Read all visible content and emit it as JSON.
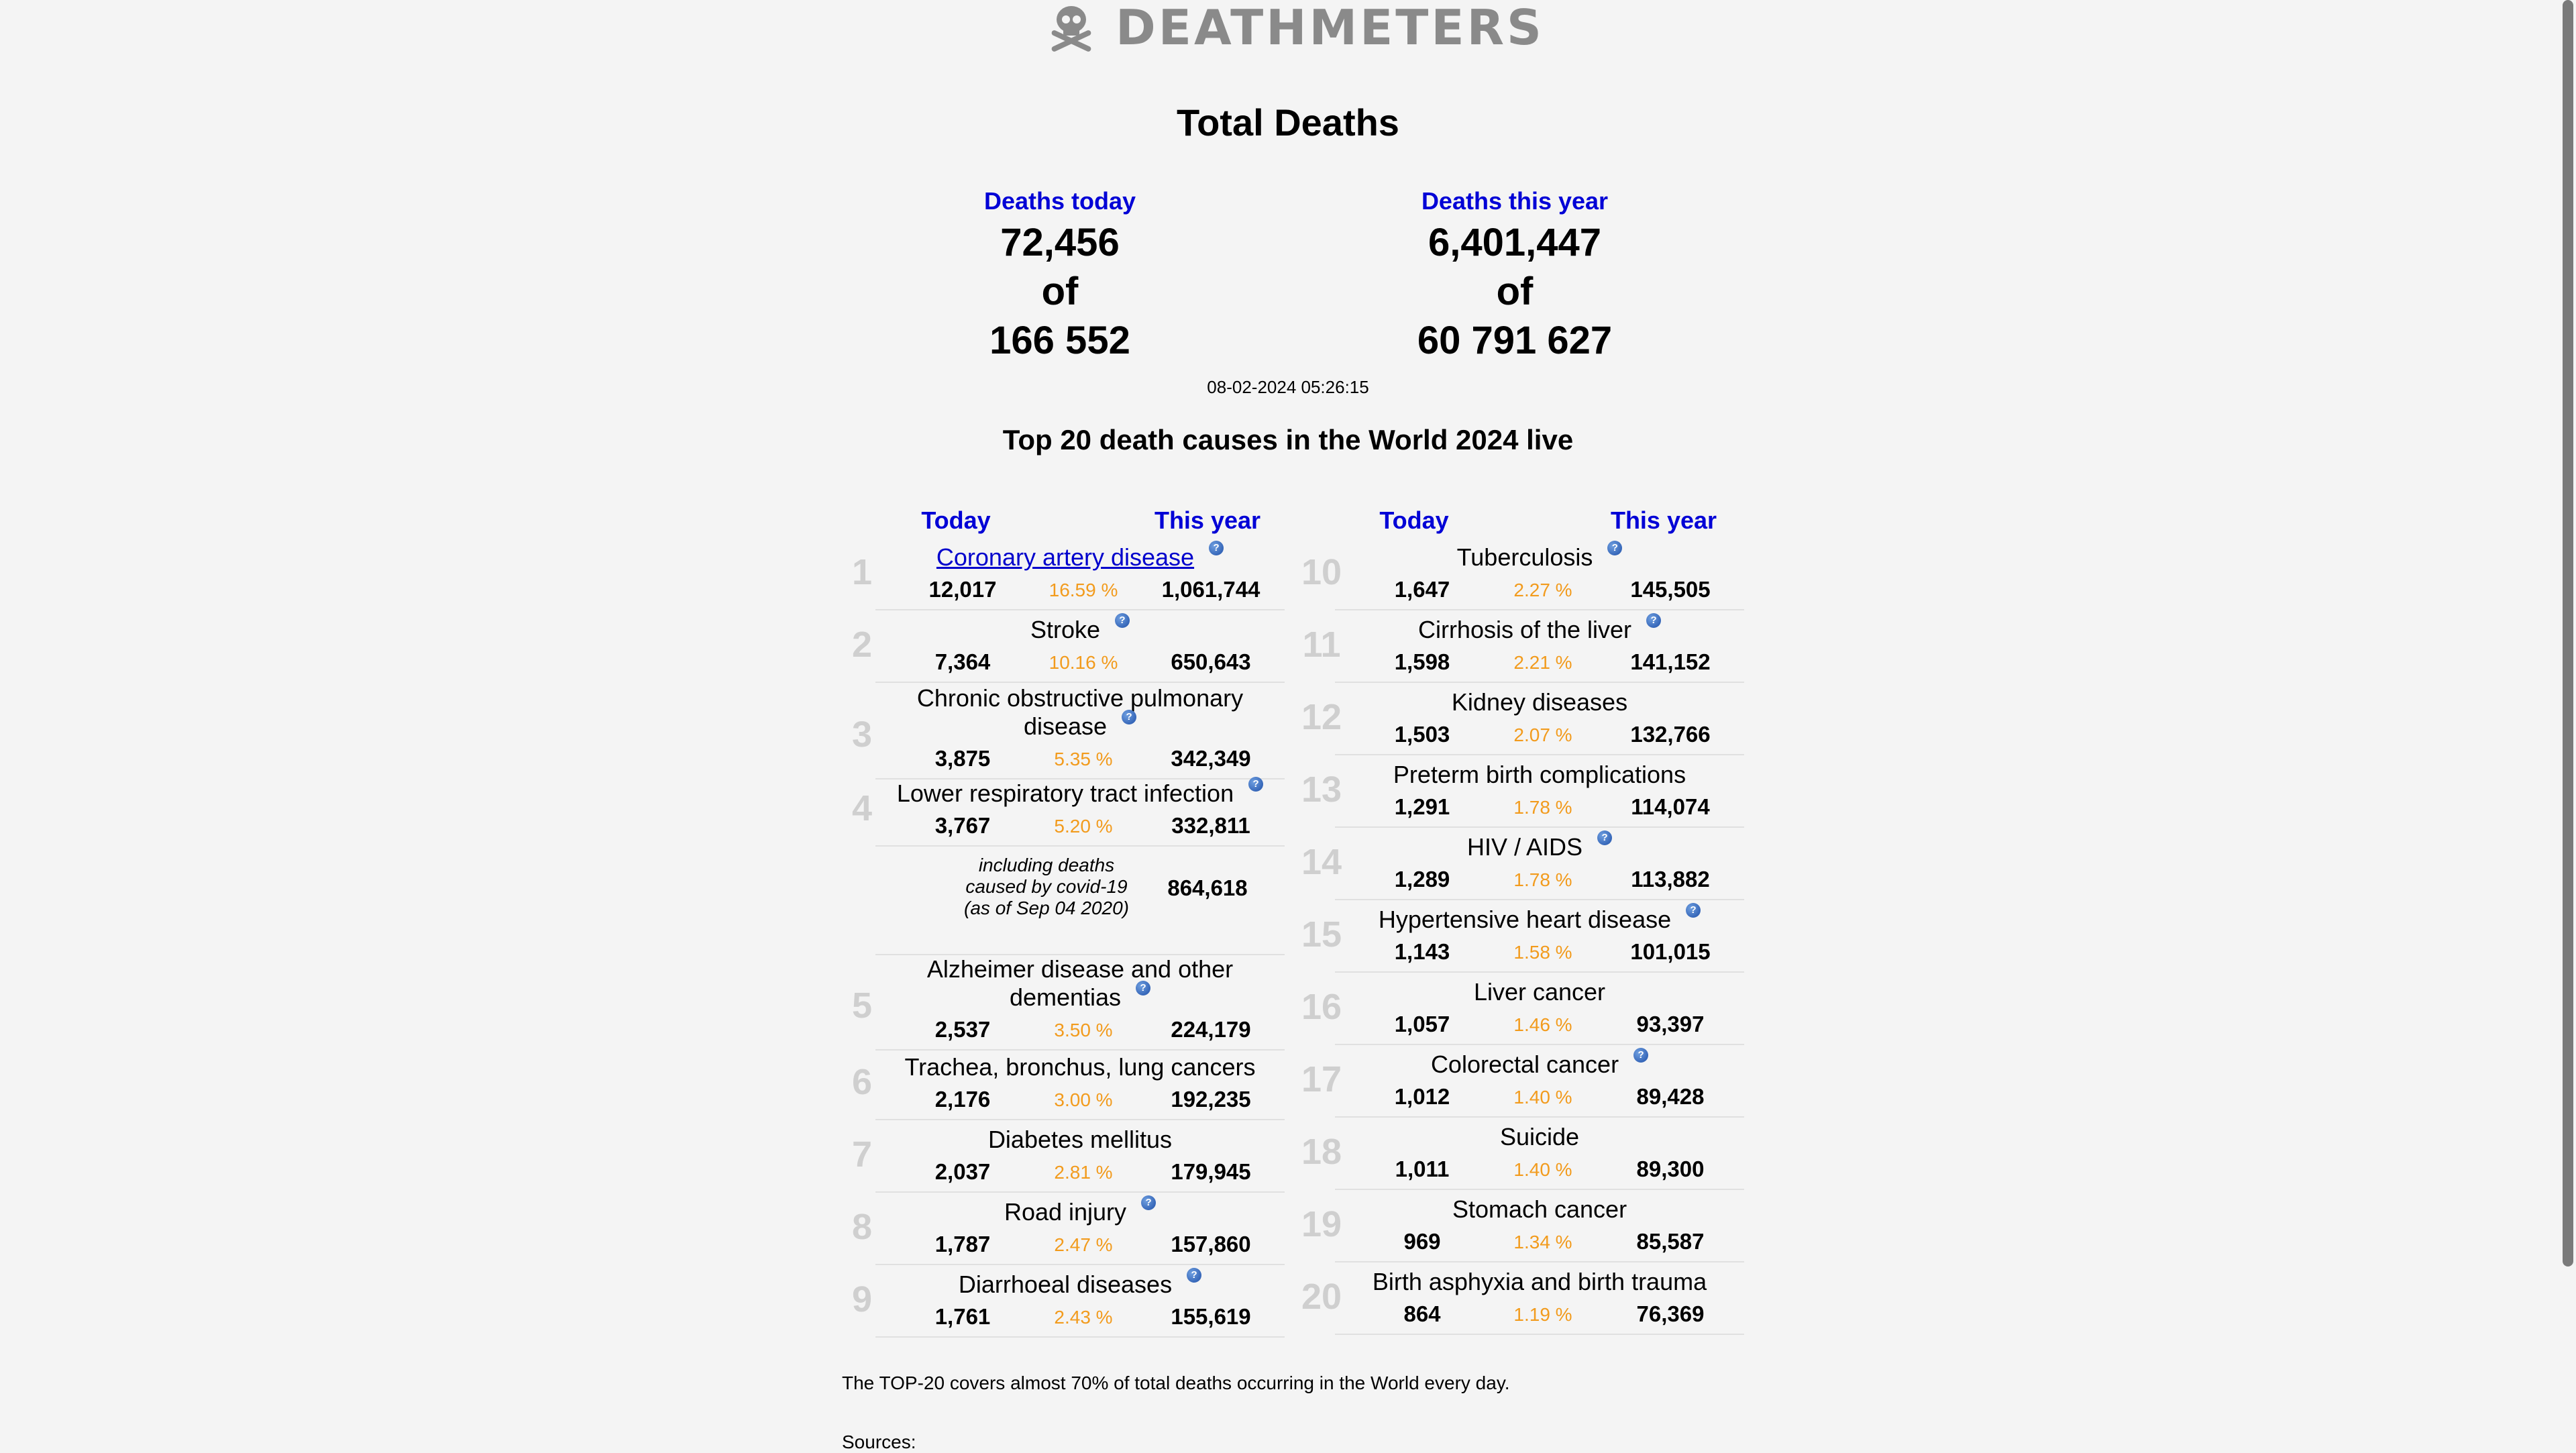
{
  "logo": {
    "text": "DEATHMETERS",
    "icon": "skull-crossbones-icon"
  },
  "title": "Total Deaths",
  "today": {
    "label": "Deaths today",
    "value": "72,456",
    "of": "of",
    "total": "166 552"
  },
  "year": {
    "label": "Deaths this year",
    "value": "6,401,447",
    "of": "of",
    "total": "60 791 627"
  },
  "timestamp": "08-02-2024 05:26:15",
  "subtitle": "Top 20 death causes in the World 2024 live",
  "headers": {
    "today": "Today",
    "year": "This year"
  },
  "causes": [
    {
      "n": "1",
      "name": "Coronary artery disease",
      "today": "12,017",
      "pct": "16.59 %",
      "year": "1,061,744"
    },
    {
      "n": "2",
      "name": "Stroke",
      "today": "7,364",
      "pct": "10.16 %",
      "year": "650,643"
    },
    {
      "n": "3",
      "name": "Chronic obstructive pulmonary disease",
      "today": "3,875",
      "pct": "5.35 %",
      "year": "342,349"
    },
    {
      "n": "4",
      "name": "Lower respiratory tract infection",
      "today": "3,767",
      "pct": "5.20 %",
      "year": "332,811"
    },
    {
      "n": "5",
      "name": "Alzheimer disease and other dementias",
      "today": "2,537",
      "pct": "3.50 %",
      "year": "224,179"
    },
    {
      "n": "6",
      "name": "Trachea, bronchus, lung cancers",
      "today": "2,176",
      "pct": "3.00 %",
      "year": "192,235"
    },
    {
      "n": "7",
      "name": "Diabetes mellitus",
      "today": "2,037",
      "pct": "2.81 %",
      "year": "179,945"
    },
    {
      "n": "8",
      "name": "Road injury",
      "today": "1,787",
      "pct": "2.47 %",
      "year": "157,860"
    },
    {
      "n": "9",
      "name": "Diarrhoeal diseases",
      "today": "1,761",
      "pct": "2.43 %",
      "year": "155,619"
    },
    {
      "n": "10",
      "name": "Tuberculosis",
      "today": "1,647",
      "pct": "2.27 %",
      "year": "145,505"
    },
    {
      "n": "11",
      "name": "Cirrhosis of the liver",
      "today": "1,598",
      "pct": "2.21 %",
      "year": "141,152"
    },
    {
      "n": "12",
      "name": "Kidney diseases",
      "today": "1,503",
      "pct": "2.07 %",
      "year": "132,766"
    },
    {
      "n": "13",
      "name": "Preterm birth complications",
      "today": "1,291",
      "pct": "1.78 %",
      "year": "114,074"
    },
    {
      "n": "14",
      "name": "HIV / AIDS",
      "today": "1,289",
      "pct": "1.78 %",
      "year": "113,882"
    },
    {
      "n": "15",
      "name": "Hypertensive heart disease",
      "today": "1,143",
      "pct": "1.58 %",
      "year": "101,015"
    },
    {
      "n": "16",
      "name": "Liver cancer",
      "today": "1,057",
      "pct": "1.46 %",
      "year": "93,397"
    },
    {
      "n": "17",
      "name": "Colorectal cancer",
      "today": "1,012",
      "pct": "1.40 %",
      "year": "89,428"
    },
    {
      "n": "18",
      "name": "Suicide",
      "today": "1,011",
      "pct": "1.40 %",
      "year": "89,300"
    },
    {
      "n": "19",
      "name": "Stomach cancer",
      "today": "969",
      "pct": "1.34 %",
      "year": "85,587"
    },
    {
      "n": "20",
      "name": "Birth asphyxia and birth trauma",
      "today": "864",
      "pct": "1.19 %",
      "year": "76,369"
    }
  ],
  "covid": {
    "note_lines": [
      "including deaths",
      "caused by covid-19",
      "(as of Sep 04 2020)"
    ],
    "value": "864,618"
  },
  "footer": {
    "coverage": "The TOP-20 covers almost 70% of total deaths occurring in the World every day.",
    "sources": "Sources:"
  },
  "colors": {
    "accent": "#0000d6",
    "percent": "#f29b1d",
    "background": "#f4f4f4"
  }
}
